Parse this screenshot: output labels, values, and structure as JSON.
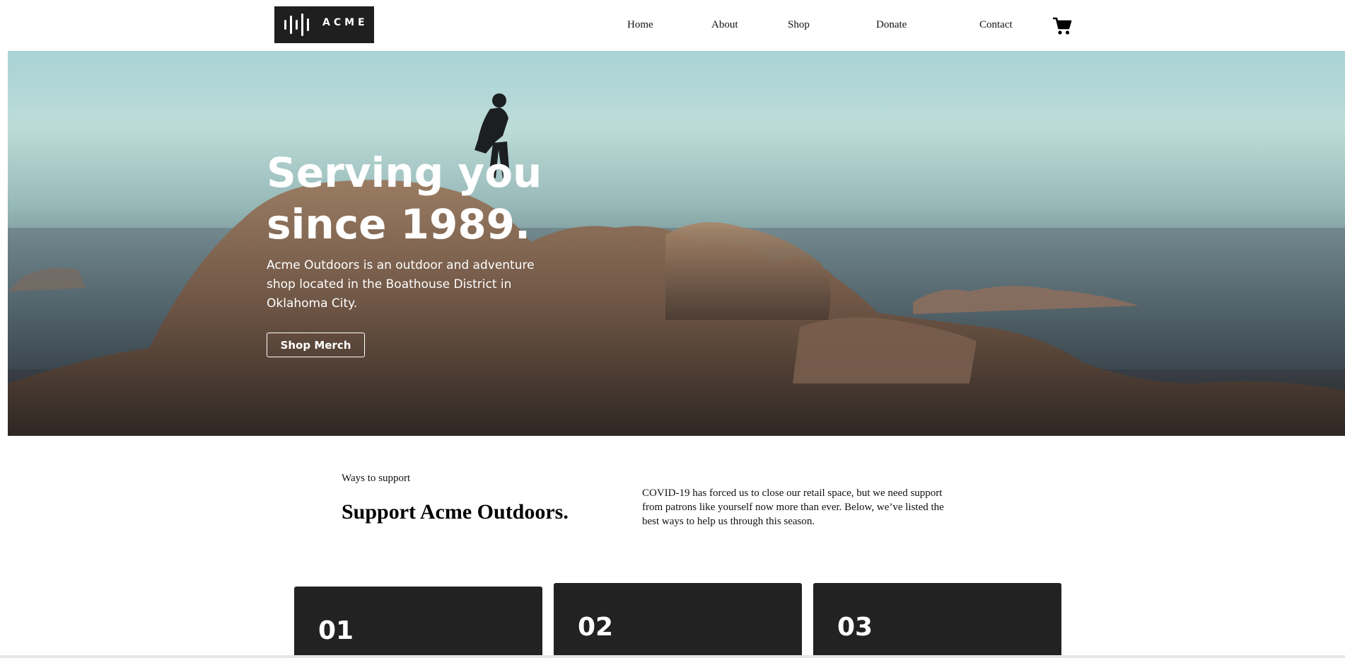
{
  "header": {
    "logo_text": "ACME",
    "nav": [
      {
        "label": "Home"
      },
      {
        "label": "About"
      },
      {
        "label": "Shop"
      },
      {
        "label": "Donate"
      },
      {
        "label": "Contact"
      }
    ],
    "cart_icon": "shopping-cart-icon"
  },
  "hero": {
    "title_line1": "Serving you",
    "title_line2": "since 1989.",
    "description": "Acme Outdoors is an outdoor and adventure shop located in the Boathouse District in Oklahoma City.",
    "button_label": "Shop Merch"
  },
  "support": {
    "eyebrow": "Ways to support",
    "title": "Support Acme Outdoors.",
    "text": "COVID-19 has forced us to close our retail space, but we need support from patrons like yourself now more than ever. Below, we’ve listed the best ways to help us through this season."
  },
  "cards": [
    {
      "number": "01"
    },
    {
      "number": "02"
    },
    {
      "number": "03"
    }
  ],
  "colors": {
    "card_bg": "#222222",
    "logo_bg": "#1f1f1f",
    "hero_text": "#ffffff"
  }
}
